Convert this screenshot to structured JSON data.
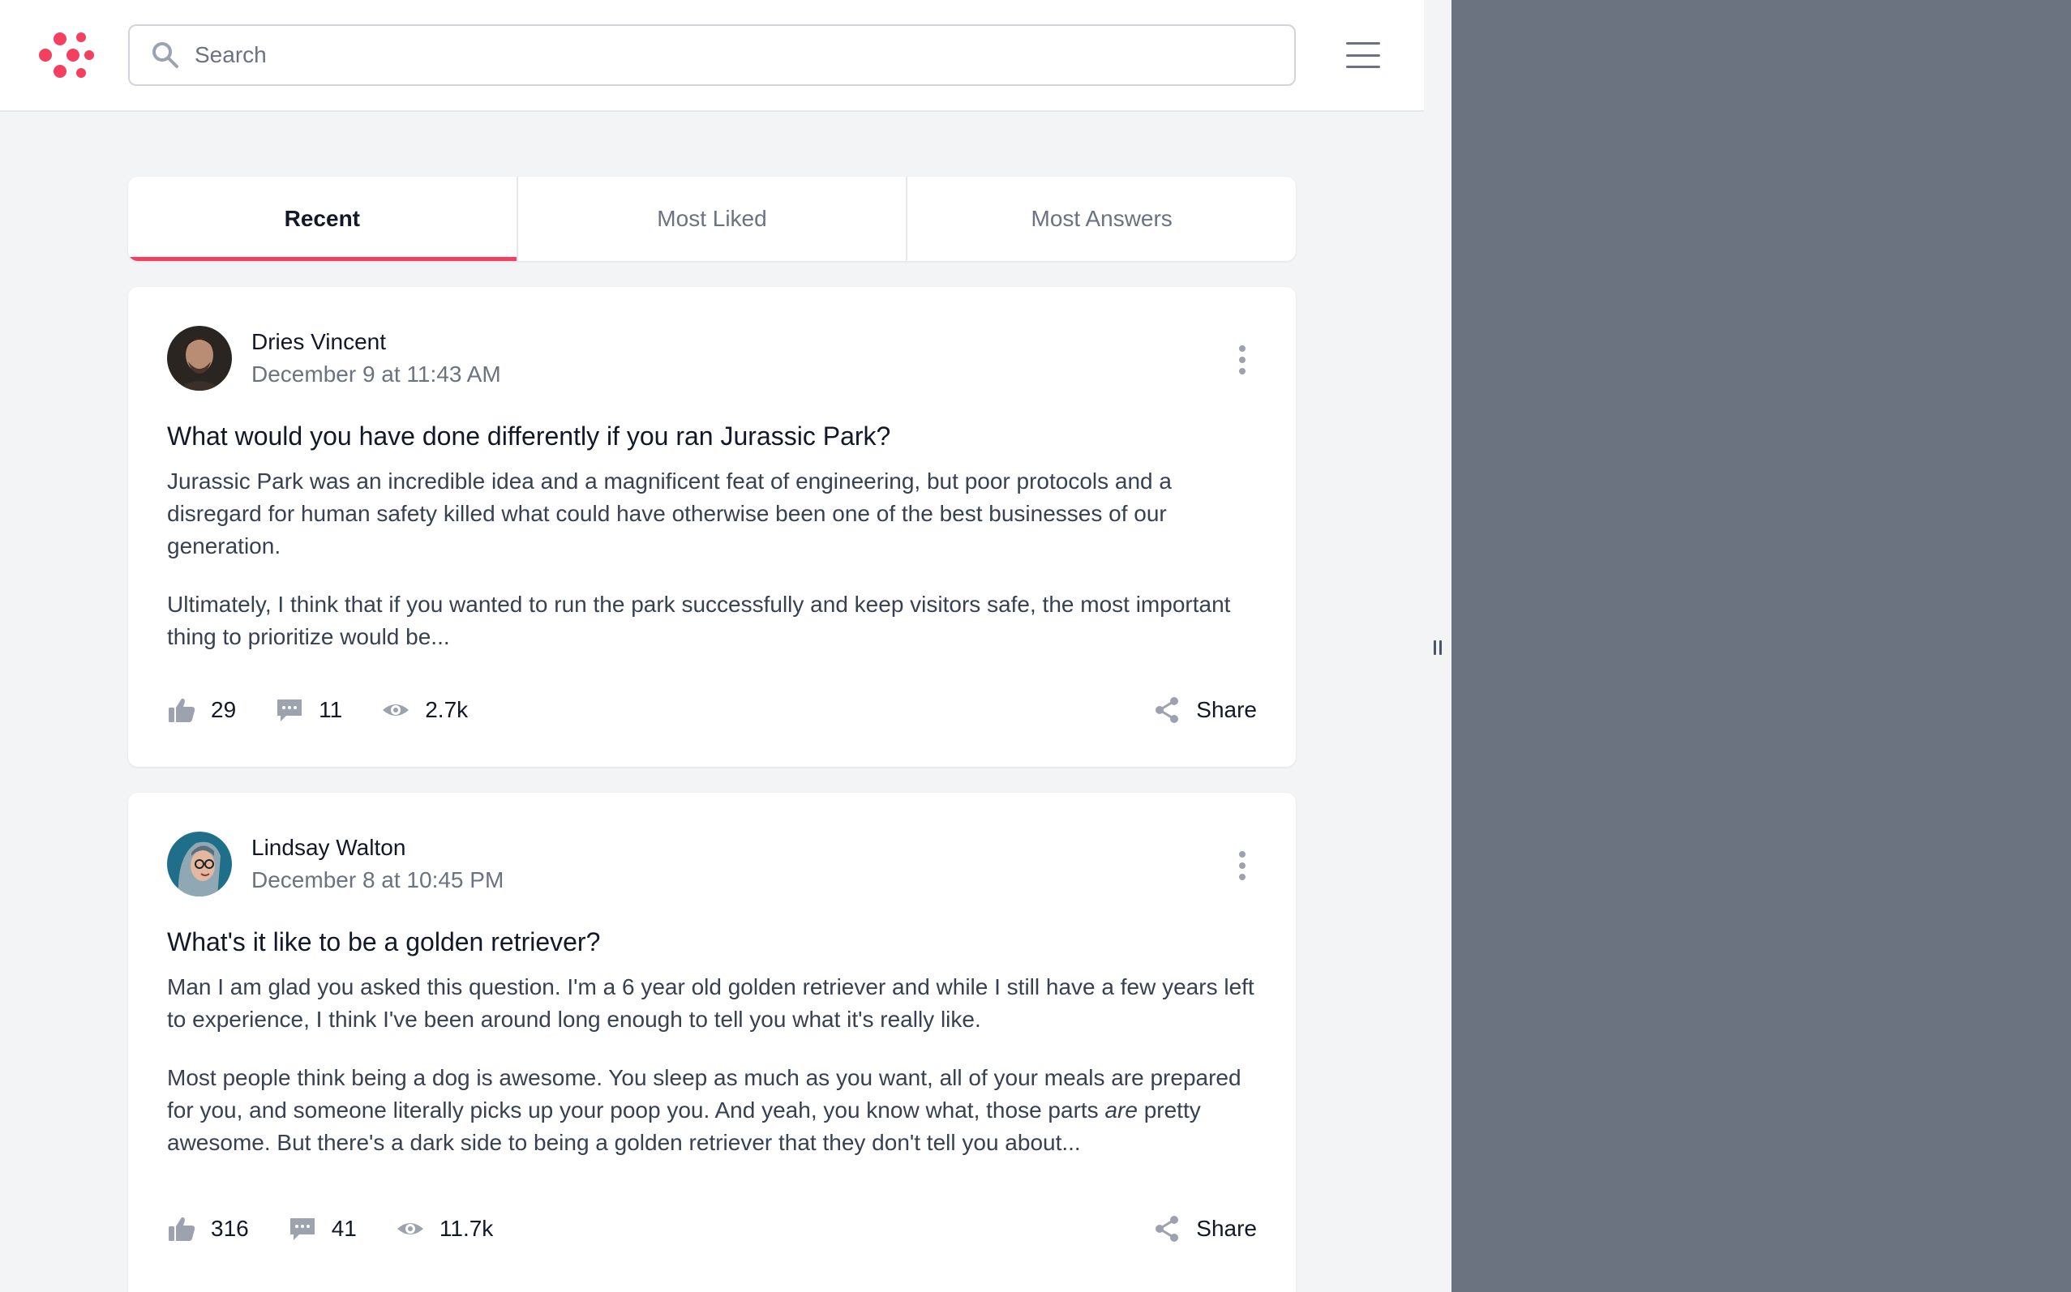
{
  "header": {
    "search_placeholder": "Search",
    "brand_color": "#f43f5e"
  },
  "tabs": [
    {
      "label": "Recent",
      "active": true
    },
    {
      "label": "Most Liked",
      "active": false
    },
    {
      "label": "Most Answers",
      "active": false
    }
  ],
  "posts": [
    {
      "author": "Dries Vincent",
      "date": "December 9 at 11:43 AM",
      "title": "What would you have done differently if you ran Jurassic Park?",
      "paragraphs": [
        "Jurassic Park was an incredible idea and a magnificent feat of engineering, but poor protocols and a disregard for human safety killed what could have otherwise been one of the best businesses of our generation.",
        "Ultimately, I think that if you wanted to run the park successfully and keep visitors safe, the most important thing to prioritize would be..."
      ],
      "likes": "29",
      "replies": "11",
      "views": "2.7k",
      "share_label": "Share"
    },
    {
      "author": "Lindsay Walton",
      "date": "December 8 at 10:45 PM",
      "title": "What's it like to be a golden retriever?",
      "paragraphs": [
        "Man I am glad you asked this question. I'm a 6 year old golden retriever and while I still have a few years left to experience, I think I've been around long enough to tell you what it's really like.",
        "Most people think being a dog is awesome. You sleep as much as you want, all of your meals are prepared for you, and someone literally picks up your poop you. And yeah, you know what, those parts",
        "are",
        "pretty awesome. But there's a dark side to being a golden retriever that they don't tell you about..."
      ],
      "likes": "316",
      "replies": "41",
      "views": "11.7k",
      "share_label": "Share"
    }
  ]
}
